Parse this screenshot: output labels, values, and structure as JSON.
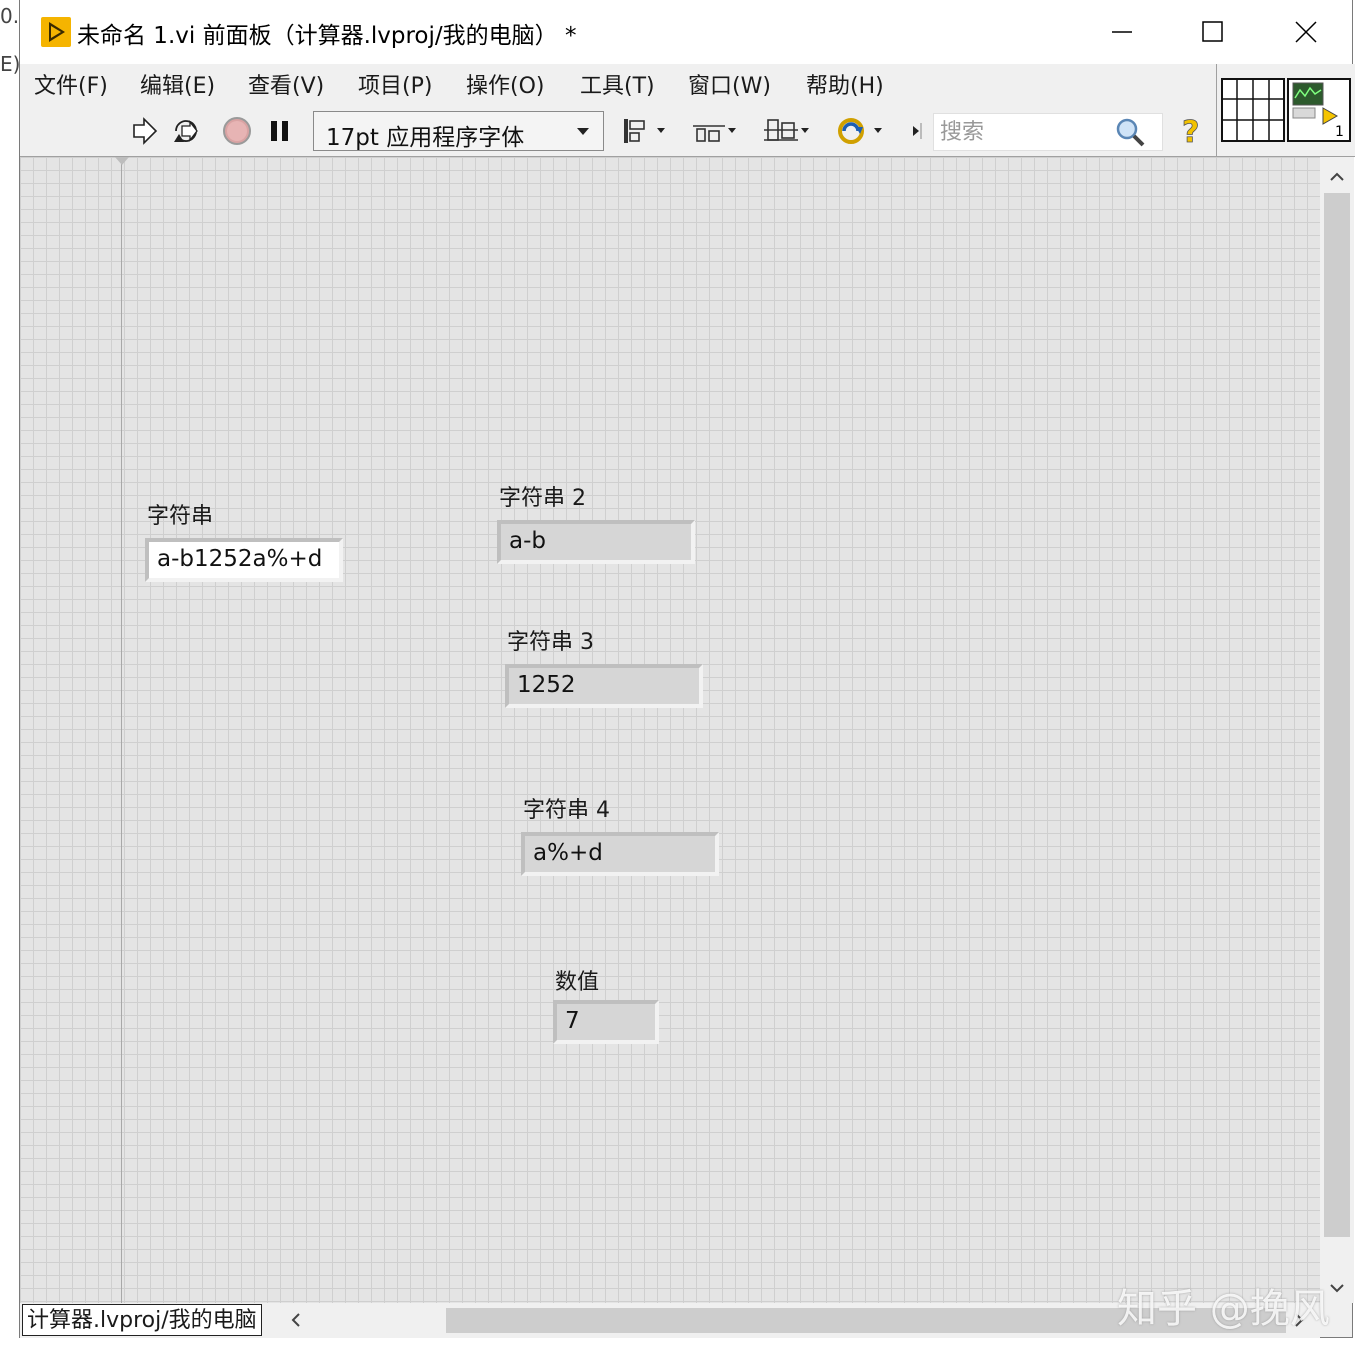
{
  "edge": {
    "top_fragment": "0.",
    "mid_fragment": "E)"
  },
  "window": {
    "title": "未命名 1.vi 前面板（计算器.lvproj/我的电脑） *",
    "minimize_glyph": "—",
    "maximize_glyph": "☐",
    "close_glyph": "✕"
  },
  "menu": [
    "文件(F)",
    "编辑(E)",
    "查看(V)",
    "项目(P)",
    "操作(O)",
    "工具(T)",
    "窗口(W)",
    "帮助(H)"
  ],
  "toolbar": {
    "font": "17pt 应用程序字体",
    "search_placeholder": "搜索",
    "icons": [
      "run-arrow-icon",
      "run-continuous-icon",
      "abort-icon",
      "pause-icon",
      "align-icon",
      "distribute-icon",
      "resize-icon",
      "reorder-icon",
      "search-icon",
      "help-icon"
    ]
  },
  "connector_pane": {
    "terminal_number": "1"
  },
  "panel": {
    "controls": [
      {
        "label": "字符串",
        "value": "a-b1252a%+d",
        "kind": "control"
      },
      {
        "label": "字符串 2",
        "value": "a-b",
        "kind": "indicator"
      },
      {
        "label": "字符串 3",
        "value": "1252",
        "kind": "indicator"
      },
      {
        "label": "字符串 4",
        "value": "a%+d",
        "kind": "indicator"
      },
      {
        "label": "数值",
        "value": "7",
        "kind": "indicator"
      }
    ]
  },
  "statusbar": {
    "context": "计算器.lvproj/我的电脑"
  },
  "watermark": "知乎 @挽风"
}
